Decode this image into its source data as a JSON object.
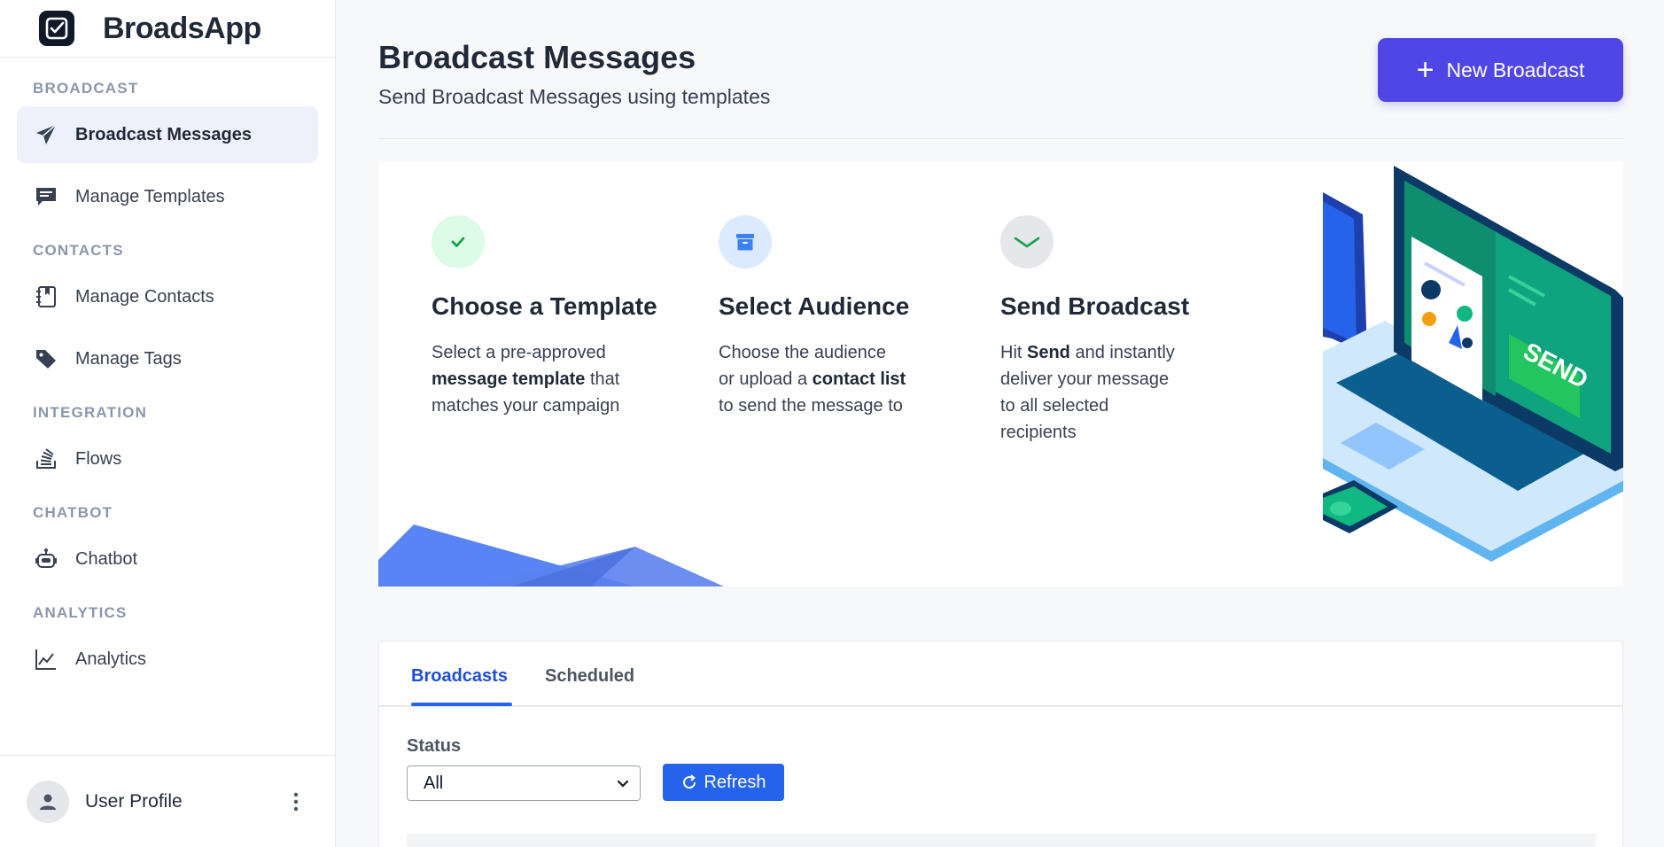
{
  "app": {
    "name": "BroadsApp",
    "logo_icon": "check-box-icon"
  },
  "sidebar": {
    "sections": [
      {
        "title": "BROADCAST",
        "items": [
          {
            "label": "Broadcast Messages",
            "icon": "paper-plane-icon",
            "active": true
          },
          {
            "label": "Manage Templates",
            "icon": "message-square-icon",
            "active": false
          }
        ]
      },
      {
        "title": "CONTACTS",
        "items": [
          {
            "label": "Manage Contacts",
            "icon": "contact-book-icon",
            "active": false
          },
          {
            "label": "Manage Tags",
            "icon": "tag-icon",
            "active": false
          }
        ]
      },
      {
        "title": "INTEGRATION",
        "items": [
          {
            "label": "Flows",
            "icon": "flows-icon",
            "active": false
          }
        ]
      },
      {
        "title": "CHATBOT",
        "items": [
          {
            "label": "Chatbot",
            "icon": "robot-icon",
            "active": false
          }
        ]
      },
      {
        "title": "ANALYTICS",
        "items": [
          {
            "label": "Analytics",
            "icon": "line-chart-icon",
            "active": false
          }
        ]
      }
    ],
    "profile": {
      "name": "User Profile",
      "icon": "user-icon",
      "menu_icon": "kebab-menu-icon"
    }
  },
  "header": {
    "title": "Broadcast Messages",
    "subtitle": "Send Broadcast Messages using templates",
    "new_button": "New Broadcast"
  },
  "steps": [
    {
      "title": "Choose a Template",
      "icon": "check-icon",
      "text": [
        "Select a pre-approved",
        "message template",
        " that",
        "matches your campaign"
      ]
    },
    {
      "title": "Select Audience",
      "icon": "archive-box-icon",
      "text": [
        "Choose the audience",
        "or upload a ",
        "contact list",
        "to send the message to"
      ]
    },
    {
      "title": "Send Broadcast",
      "icon": "chevron-down-icon",
      "text": [
        "Hit ",
        "Send",
        " and instantly",
        "deliver your message",
        "to all selected",
        "recipients"
      ]
    }
  ],
  "illustration": {
    "screen_label": "SEND"
  },
  "broadcast_panel": {
    "tabs": [
      {
        "label": "Broadcasts",
        "active": true
      },
      {
        "label": "Scheduled",
        "active": false
      }
    ],
    "status_label": "Status",
    "status_value": "All",
    "refresh_label": "Refresh"
  },
  "colors": {
    "primary": "#4f46e5",
    "blue": "#2563eb",
    "green": "#22c55e",
    "text": "#1f2937"
  }
}
